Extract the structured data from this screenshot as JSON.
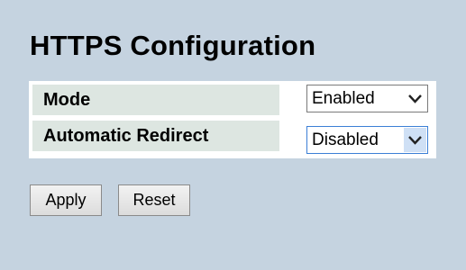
{
  "page": {
    "title": "HTTPS Configuration"
  },
  "settings": [
    {
      "label": "Mode",
      "value": "Enabled"
    },
    {
      "label": "Automatic Redirect",
      "value": "Disabled"
    }
  ],
  "buttons": {
    "apply_label": "Apply",
    "reset_label": "Reset"
  },
  "colors": {
    "background": "#c5d3e0",
    "label_cell": "#dde6e1",
    "focus_border": "#3b7fd6"
  },
  "icons": {
    "dropdown": "chevron-down-icon"
  }
}
